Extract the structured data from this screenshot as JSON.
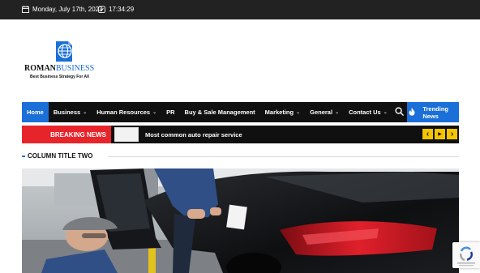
{
  "topbar": {
    "date": "Monday, July 17th, 2023",
    "time": "17:34:29"
  },
  "logo": {
    "name_part1": "ROMAN",
    "name_part2": "BUSINESS",
    "tagline": "Best Business Strategy For All"
  },
  "nav": {
    "items": [
      {
        "label": "Home",
        "active": true,
        "dropdown": false
      },
      {
        "label": "Business",
        "active": false,
        "dropdown": true
      },
      {
        "label": "Human Resources",
        "active": false,
        "dropdown": true
      },
      {
        "label": "PR",
        "active": false,
        "dropdown": false
      },
      {
        "label": "Buy & Sale Management",
        "active": false,
        "dropdown": false
      },
      {
        "label": "Marketing",
        "active": false,
        "dropdown": true
      },
      {
        "label": "General",
        "active": false,
        "dropdown": true
      },
      {
        "label": "Contact Us",
        "active": false,
        "dropdown": true
      }
    ],
    "chevron": "⌄",
    "trending_label": "Trending News"
  },
  "breaking": {
    "label": "BREAKING NEWS",
    "headline": "Most common auto repair service",
    "controls": [
      "‹",
      "▶",
      "›"
    ]
  },
  "section": {
    "title": "COLUMN TITLE TWO"
  },
  "colors": {
    "accent": "#1a6fd8",
    "breaking_red": "#e8242b",
    "control_yellow": "#f5c400",
    "dark": "#101010"
  },
  "icons": {
    "date": "calendar-icon",
    "time": "clock-icon",
    "search": "search-icon",
    "trending": "flame-icon"
  }
}
